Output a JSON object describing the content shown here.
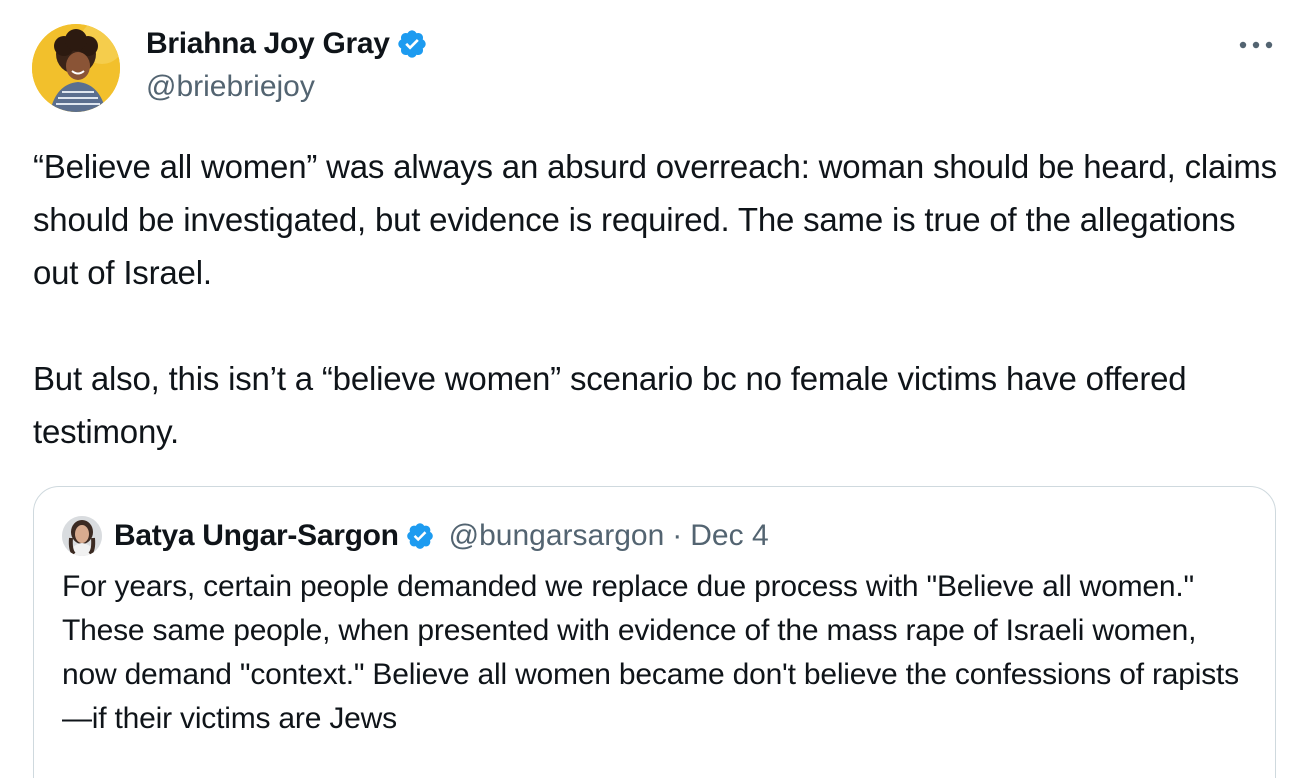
{
  "author": {
    "display_name": "Briahna Joy Gray",
    "handle": "@briebriejoy",
    "verified": true
  },
  "tweet": {
    "text": "“Believe all women” was always an absurd overreach: woman should be heard, claims should be investigated, but evidence is required. The same is true of the allegations out of Israel.\n\nBut also, this isn’t a “believe women” scenario bc no female victims have offered testimony."
  },
  "quoted_tweet": {
    "display_name": "Batya Ungar-Sargon",
    "handle": "@bungarsargon",
    "separator": "·",
    "date": "Dec 4",
    "verified": true,
    "text": "For years, certain people demanded we replace due process with \"Believe all women.\" These same people, when presented with evidence of the mass rape of Israeli women, now demand \"context.\" Believe all women became don't believe the confessions of rapists—if their victims are Jews"
  },
  "icons": {
    "verified": "verified-badge-icon",
    "more": "more-options-icon"
  },
  "colors": {
    "text_primary": "#0f1419",
    "text_secondary": "#536471",
    "verified_blue": "#1d9bf0",
    "border": "#cfd9de"
  }
}
